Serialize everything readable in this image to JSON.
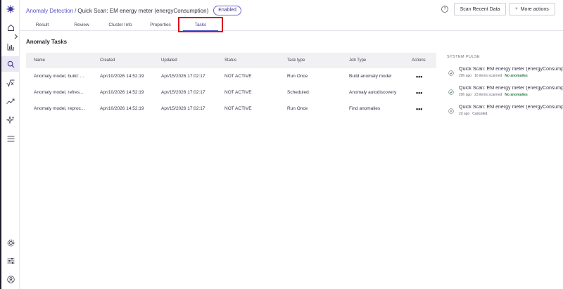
{
  "breadcrumb": {
    "parent": "Anomaly Detection",
    "separator": "/",
    "current": "Quick Scan: EM energy meter (energyConsumption)"
  },
  "status_badge": "Enabled",
  "header": {
    "help": "?",
    "scan_button": "Scan Recent Data",
    "more_plus": "+",
    "more_button": "More actions"
  },
  "tabs": [
    {
      "label": "Result"
    },
    {
      "label": "Review"
    },
    {
      "label": "Cluster Info"
    },
    {
      "label": "Properties"
    },
    {
      "label": "Tasks",
      "active": true
    }
  ],
  "section_title": "Anomaly Tasks",
  "table": {
    "headers": [
      "Name",
      "Created",
      "Updated",
      "Status",
      "Task type",
      "Job Type",
      "Actions"
    ],
    "rows": [
      {
        "name": "Anomaly model, build: ...",
        "created": "Apr/10/2026 14:52:19",
        "updated": "Apr/15/2026 17:02:17",
        "status": "NOT ACTIVE",
        "task_type": "Run Once",
        "job_type": "Build anomaly model",
        "actions": "•••"
      },
      {
        "name": "Anomaly model, refres...",
        "created": "Apr/10/2026 14:52:19",
        "updated": "Apr/15/2026 17:02:17",
        "status": "NOT ACTIVE",
        "task_type": "Scheduled",
        "job_type": "Anomaly autodiscovery",
        "actions": "•••"
      },
      {
        "name": "Anomaly model, reproc...",
        "created": "Apr/10/2026 14:52:19",
        "updated": "Apr/15/2026 17:02:17",
        "status": "NOT ACTIVE",
        "task_type": "Run Once",
        "job_type": "Find anomalies",
        "actions": "•••"
      }
    ]
  },
  "system_pulse": {
    "title": "SYSTEM PULSE",
    "items": [
      {
        "name": "Quick Scan: EM energy meter (energyConsumption)",
        "time": "20h ago",
        "scanned": "16 items scanned",
        "result": "No anomalies",
        "state": "success"
      },
      {
        "name": "Quick Scan: EM energy meter (energyConsumption)",
        "time": "20h ago",
        "scanned": "23 items scanned",
        "result": "No anomalies",
        "state": "success"
      },
      {
        "name": "Quick Scan: EM energy meter (energyConsumption)",
        "time": "2d ago",
        "scanned": "",
        "result": "Canceled",
        "state": "canceled"
      }
    ]
  },
  "colors": {
    "accent": "#5a55c4",
    "highlight": "#d6131d",
    "success": "#2e7d4b"
  },
  "icons": [
    "logo-icon",
    "home-icon",
    "bar-chart-icon",
    "search-icon",
    "sqrt-icon",
    "trend-icon",
    "sparkle-icon",
    "menu-icon",
    "gear-icon",
    "sliders-icon",
    "user-icon",
    "chevron-right-icon",
    "help-icon"
  ]
}
